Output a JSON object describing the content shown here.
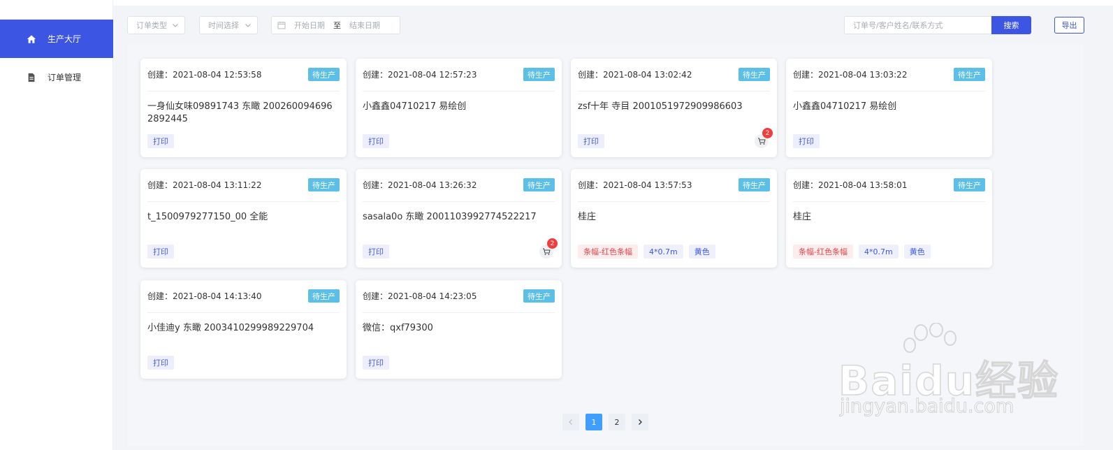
{
  "sidebar": {
    "items": [
      {
        "label": "生产大厅",
        "icon": "home-icon",
        "active": true
      },
      {
        "label": "订单管理",
        "icon": "document-icon",
        "active": false
      }
    ]
  },
  "filters": {
    "order_type": "订单类型",
    "time_select": "时间选择",
    "start_date": "开始日期",
    "range_sep": "至",
    "end_date": "结束日期",
    "search_placeholder": "订单号/客户姓名/联系方式",
    "search_label": "搜索",
    "export_label": "导出"
  },
  "colors": {
    "accent": "#3d55e3",
    "badge": "#5bbfe8",
    "pager_active": "#409eff"
  },
  "cards": [
    {
      "created": "创建：2021-08-04 12:53:58",
      "status": "待生产",
      "customer": "一身仙女味09891743 东瞰 2002600946962892445",
      "print": "打印"
    },
    {
      "created": "创建：2021-08-04 12:57:23",
      "status": "待生产",
      "customer": "小鑫鑫04710217 易绘创",
      "print": "打印"
    },
    {
      "created": "创建：2021-08-04 13:02:42",
      "status": "待生产",
      "customer": "zsf十年 寺目 2001051972909986603",
      "print": "打印",
      "cart_count": "2"
    },
    {
      "created": "创建：2021-08-04 13:03:22",
      "status": "待生产",
      "customer": "小鑫鑫04710217 易绘创",
      "print": "打印"
    },
    {
      "created": "创建：2021-08-04 13:11:22",
      "status": "待生产",
      "customer": "t_1500979277150_00 全能",
      "print": "打印"
    },
    {
      "created": "创建：2021-08-04 13:26:32",
      "status": "待生产",
      "customer": "sasala0o 东瞰 2001103992774522217",
      "print": "打印",
      "cart_count": "2"
    },
    {
      "created": "创建：2021-08-04 13:57:53",
      "status": "待生产",
      "customer": "桂庄",
      "tag_product": "条幅-红色条幅",
      "tag_size": "4*0.7m",
      "tag_color": "黄色"
    },
    {
      "created": "创建：2021-08-04 13:58:01",
      "status": "待生产",
      "customer": "桂庄",
      "tag_product": "条幅-红色条幅",
      "tag_size": "4*0.7m",
      "tag_color": "黄色"
    },
    {
      "created": "创建：2021-08-04 14:13:40",
      "status": "待生产",
      "customer": "小佳迪y 东瞰 2003410299989229704",
      "print": "打印"
    },
    {
      "created": "创建：2021-08-04 14:23:05",
      "status": "待生产",
      "customer": "微信：qxf79300",
      "print": "打印"
    }
  ],
  "pagination": {
    "pages": [
      "1",
      "2"
    ],
    "current": "1"
  },
  "watermark": {
    "brand": "Baidu经验",
    "url": "jingyan.baidu.com"
  }
}
